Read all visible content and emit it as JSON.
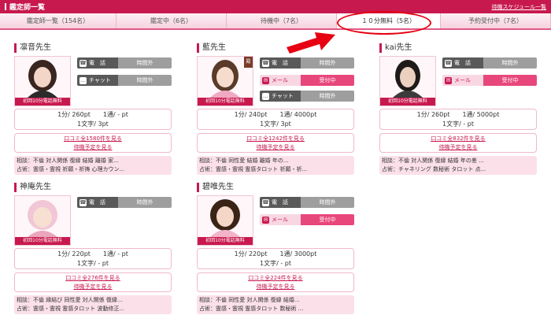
{
  "header": {
    "title": "鑑定師一覧",
    "schedule_link": "待機スケジュール一覧"
  },
  "tabs": [
    {
      "label": "鑑定師一覧（154名）"
    },
    {
      "label": "鑑定中（6名）"
    },
    {
      "label": "待機中（7名）"
    },
    {
      "label": "１０分無料（5名）"
    },
    {
      "label": "予約受付中（7名）"
    }
  ],
  "colors": {
    "accent": "#c8194f",
    "active_button": "#e8477c",
    "offline_button": "#9e9e9e",
    "annotation": "#e60012"
  },
  "labels": {
    "phone": "電　話",
    "chat": "チャット",
    "mail": "メール",
    "first_free": "初回10分電話無料",
    "book": "待機予定を見る",
    "rank": "殿堂"
  },
  "advisors": [
    {
      "name": "凛音先生",
      "phone_status": "時間外",
      "chat_status": "時間外",
      "price_line1": "1分/ 260pt　　1通/ - pt",
      "price_line2": "1文字/ 3pt",
      "reviews": "口コミ全1580件を見る",
      "consult": "相談：不倫 対人関係 復縁 結婚 離婚 家...",
      "method": "占術：霊感・霊視 祈願・祈祷 心理カウン..."
    },
    {
      "name": "藍先生",
      "phone_status": "時間外",
      "mail_status": "受付中",
      "chat_status": "時間外",
      "price_line1": "1分/ 240pt　　1通/ 4000pt",
      "price_line2": "1文字/ 3pt",
      "reviews": "口コミ全1242件を見る",
      "consult": "相談：不倫 同性愛 結婚 離婚 年の...",
      "method": "占術：霊感・霊視 霊感タロット 祈願・祈..."
    },
    {
      "name": "kai先生",
      "phone_status": "時間外",
      "mail_status": "受付中",
      "price_line1": "1分/ 260pt　　1通/ 5000pt",
      "price_line2": "1文字/ - pt",
      "reviews": "口コミ全832件を見る",
      "consult": "相談：不倫 対人関係 復縁 結婚 年の差 ...",
      "method": "占術：チャネリング 数秘術 タロット 点..."
    },
    {
      "name": "神庵先生",
      "phone_status": "時間外",
      "price_line1": "1分/ 220pt　　1通/ - pt",
      "price_line2": "1文字/ - pt",
      "reviews": "口コミ全276件を見る",
      "consult": "相談：不倫 縁結び 同性愛 対人関係 復縁...",
      "method": "占術：霊感・霊視 霊感タロット 波動修正..."
    },
    {
      "name": "碧唯先生",
      "phone_status": "時間外",
      "mail_status": "受付中",
      "price_line1": "1分/ 220pt　　1通/ 3000pt",
      "price_line2": "1文字/ - pt",
      "reviews": "口コミ全224件を見る",
      "consult": "相談：不倫 同性愛 対人関係 復縁 結婚...",
      "method": "占術：霊感・霊視 霊感タロット 数秘術 ..."
    }
  ]
}
